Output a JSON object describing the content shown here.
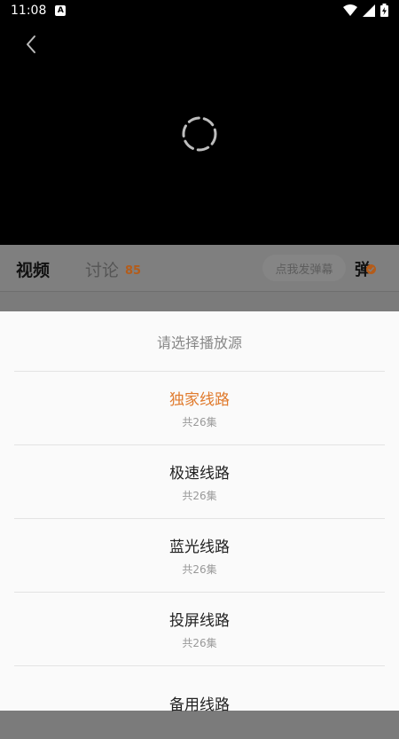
{
  "status_bar": {
    "time": "11:08",
    "notification_letter": "A"
  },
  "tabs": {
    "video": "视频",
    "discuss": "讨论",
    "discuss_count": "85"
  },
  "danmaku": {
    "input_placeholder": "点我发弹幕",
    "toggle_label": "弹"
  },
  "sheet": {
    "title": "请选择播放源",
    "sources": [
      {
        "name": "独家线路",
        "count": "共26集",
        "active": true
      },
      {
        "name": "极速线路",
        "count": "共26集",
        "active": false
      },
      {
        "name": "蓝光线路",
        "count": "共26集",
        "active": false
      },
      {
        "name": "投屏线路",
        "count": "共26集",
        "active": false
      },
      {
        "name": "备用线路",
        "count": "",
        "active": false
      }
    ]
  },
  "colors": {
    "accent": "#e07a2c",
    "player_bg": "#000000"
  }
}
